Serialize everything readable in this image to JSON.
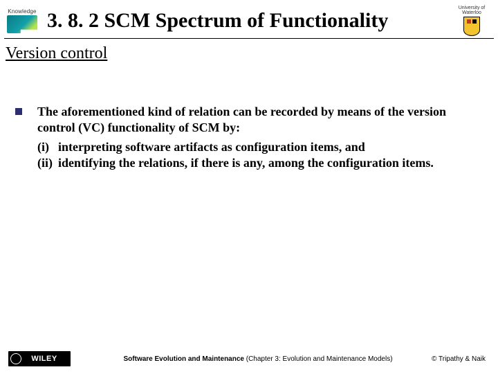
{
  "header": {
    "left_logo_caption": "Knowledge",
    "title": "3. 8. 2 SCM Spectrum of Functionality",
    "right_logo_top": "University of",
    "right_logo_name": "Waterloo"
  },
  "subtitle": "Version control",
  "body": {
    "lead": "The aforementioned kind of relation can be recorded by means of the version control (VC) functionality of SCM by:",
    "items": [
      {
        "num": "(i)",
        "text": "interpreting software artifacts as configuration items, and"
      },
      {
        "num": "(ii)",
        "text": "identifying the relations, if there is any, among the configuration items."
      }
    ]
  },
  "footer": {
    "publisher": "WILEY",
    "center_bold": "Software Evolution and Maintenance",
    "center_rest": " (Chapter 3: Evolution and Maintenance Models)",
    "right": "© Tripathy & Naik"
  }
}
